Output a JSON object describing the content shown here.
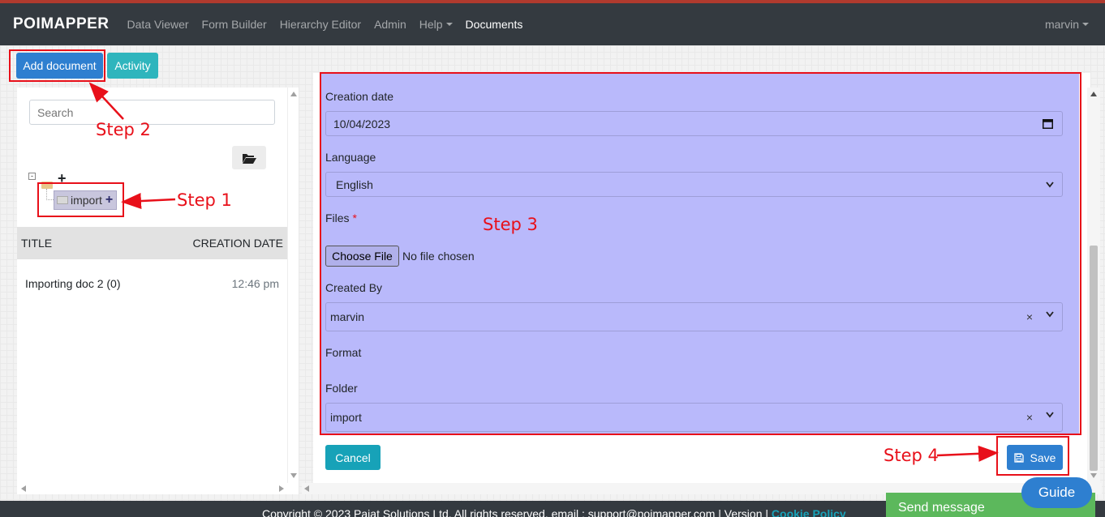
{
  "navbar": {
    "brand": "POIMAPPER",
    "links": [
      "Data Viewer",
      "Form Builder",
      "Hierarchy Editor",
      "Admin",
      "Help",
      "Documents"
    ],
    "user": "marvin"
  },
  "toolbar": {
    "add_document": "Add document",
    "activity": "Activity"
  },
  "sidebar": {
    "search_placeholder": "Search",
    "tree": {
      "folder_label": "import"
    },
    "table": {
      "headers": [
        "TITLE",
        "CREATION DATE"
      ],
      "rows": [
        {
          "title": "Importing doc 2 (0)",
          "date": "12:46 pm"
        }
      ]
    }
  },
  "form": {
    "creation_date_label": "Creation date",
    "creation_date_value": "10/04/2023",
    "language_label": "Language",
    "language_value": "English",
    "files_label": "Files",
    "files_required": "*",
    "choose_file": "Choose File",
    "no_file": "No file chosen",
    "created_by_label": "Created By",
    "created_by_value": "marvin",
    "format_label": "Format",
    "folder_label": "Folder",
    "folder_value": "import",
    "clear_symbol": "×",
    "cancel": "Cancel",
    "save": "Save"
  },
  "annotations": {
    "step1": "Step 1",
    "step2": "Step 2",
    "step3": "Step 3",
    "step4": "Step 4",
    "color": "#e8101a"
  },
  "footer": {
    "text": "Copyright © 2023 Pajat Solutions Ltd. All rights reserved. email : support@poimapper.com | Version | ",
    "cookie_link": "Cookie Policy"
  },
  "widgets": {
    "send_message": "Send message",
    "guide": "Guide"
  },
  "colors": {
    "navbar": "#343a40",
    "primary": "#2e7fd0",
    "info": "#2fb5bd",
    "form_highlight": "#b9b9fb",
    "send_message": "#5cb85c"
  }
}
